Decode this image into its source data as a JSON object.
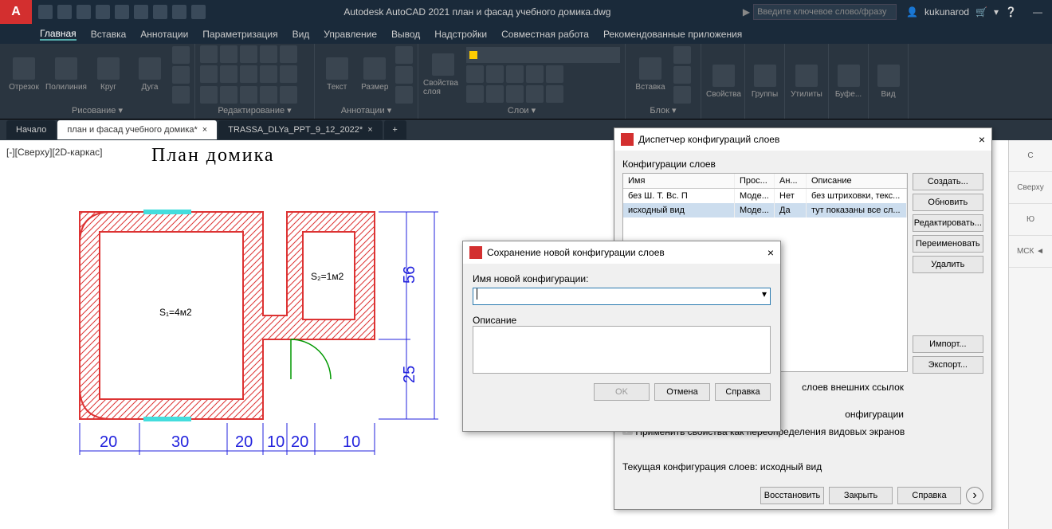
{
  "app": {
    "title": "Autodesk AutoCAD 2021   план и фасад учебного домика.dwg",
    "search_placeholder": "Введите ключевое слово/фразу",
    "username": "kukunarod"
  },
  "ribbon_tabs": [
    "Главная",
    "Вставка",
    "Аннотации",
    "Параметризация",
    "Вид",
    "Управление",
    "Вывод",
    "Надстройки",
    "Совместная работа",
    "Рекомендованные приложения"
  ],
  "ribbon_panels": {
    "draw": {
      "title": "Рисование ▾",
      "items": [
        "Отрезок",
        "Полилиния",
        "Круг",
        "Дуга"
      ]
    },
    "edit": {
      "title": "Редактирование ▾"
    },
    "anno": {
      "title": "Аннотации ▾",
      "items": [
        "Текст",
        "Размер"
      ]
    },
    "layer": {
      "title": "Слои ▾",
      "item": "Свойства слоя"
    },
    "block": {
      "title": "Блок ▾",
      "item": "Вставка"
    },
    "props": {
      "title": "Свойства"
    },
    "groups": {
      "title": "Группы"
    },
    "utils": {
      "title": "Утилиты"
    },
    "clip": {
      "title": "Буфе..."
    },
    "view": {
      "title": "Вид"
    }
  },
  "dwg_tabs": {
    "home": "Начало",
    "t1": "план и фасад учебного домика*",
    "t2": "TRASSA_DLYa_PPT_9_12_2022*"
  },
  "viewport": {
    "label": "[-][Сверху][2D-каркас]",
    "title": "План  домика"
  },
  "side": {
    "s1": "C",
    "s2": "Сверху",
    "s3": "Ю",
    "s4": "МСК ◄"
  },
  "dims": {
    "d20a": "20",
    "d30": "30",
    "d20b": "20",
    "d10a": "10",
    "d20c": "20",
    "d10b": "10",
    "v25": "25",
    "v56": "56",
    "s1": "S₁=4м2",
    "s2": "S₂=1м2"
  },
  "layer_mgr": {
    "title": "Диспетчер конфигураций слоев",
    "group": "Конфигурации слоев",
    "cols": {
      "c1": "Имя",
      "c2": "Прос...",
      "c3": "Ан...",
      "c4": "Описание"
    },
    "rows": [
      {
        "name": "без Ш. Т. Вс. П",
        "space": "Моде...",
        "as": "Нет",
        "desc": "без штриховки, текс..."
      },
      {
        "name": "исходный вид",
        "space": "Моде...",
        "as": "Да",
        "desc": "тут показаны все сл..."
      }
    ],
    "btns": {
      "new": "Создать...",
      "upd": "Обновить",
      "edit": "Редактировать...",
      "ren": "Переименовать",
      "del": "Удалить",
      "imp": "Импорт...",
      "exp": "Экспорт..."
    },
    "xref": "слоев внешних ссылок",
    "restore_sec": "онфигурации",
    "chk": "Применить свойства как переопределения видовых экранов",
    "current": "Текущая конфигурация слоев: исходный вид",
    "bottom": {
      "restore": "Восстановить",
      "close": "Закрыть",
      "help": "Справка"
    }
  },
  "save_dlg": {
    "title": "Сохранение новой конфигурации слоев",
    "name_label": "Имя новой конфигурации:",
    "desc_label": "Описание",
    "ok": "OK",
    "cancel": "Отмена",
    "help": "Справка"
  }
}
